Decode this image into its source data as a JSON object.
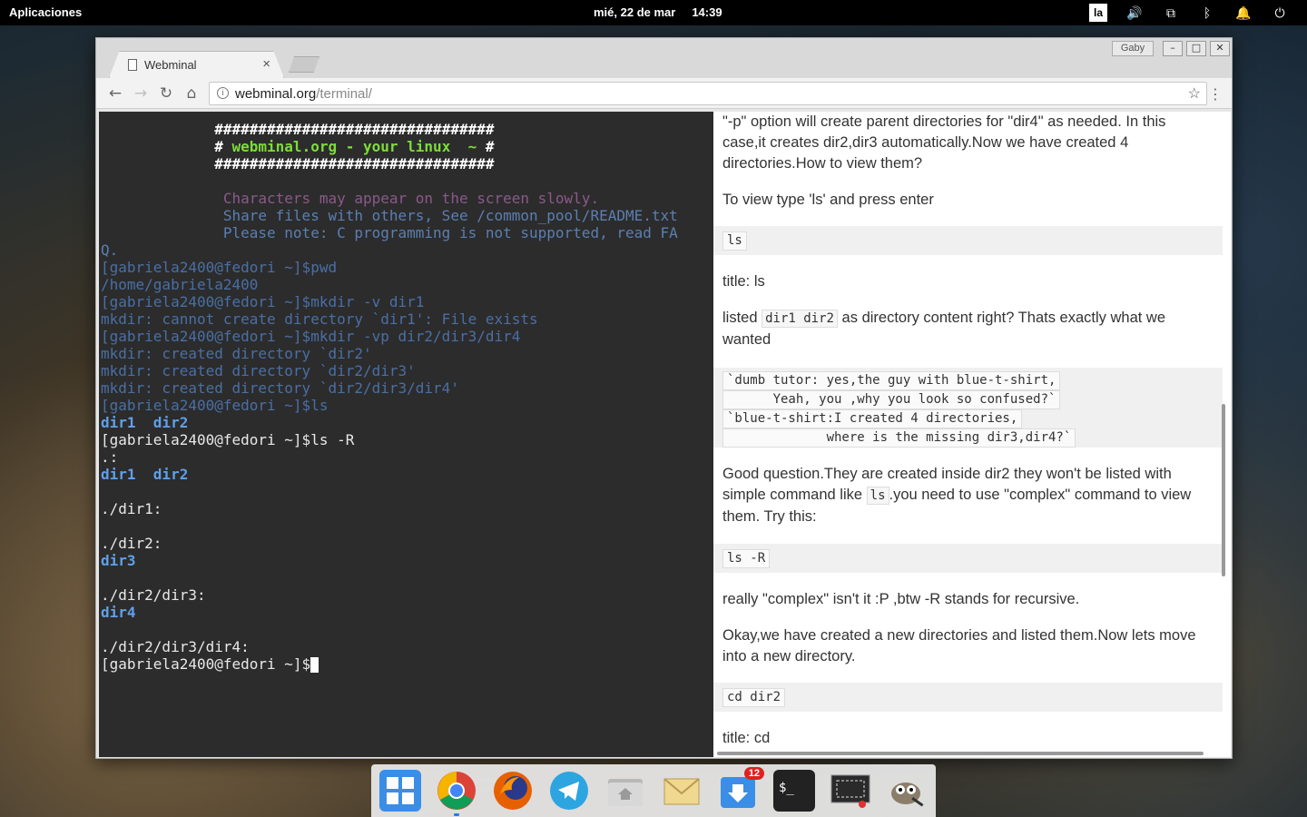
{
  "top_panel": {
    "apps_label": "Aplicaciones",
    "date": "mié, 22 de mar",
    "time": "14:39",
    "lang": "la"
  },
  "browser": {
    "tab_title": "Webminal",
    "profile": "Gaby",
    "url_host": "webminal.org",
    "url_path": "/terminal/"
  },
  "terminal": {
    "banner_hash": "################################",
    "banner_title_pre": "# ",
    "banner_title": "webminal.org - your linux  ~",
    "banner_title_post": " #",
    "motd1": "Characters may appear on the screen slowly.",
    "motd2": "Share files with others, See /common_pool/README.txt",
    "motd3": "Please note: C programming is not supported, read FA",
    "motd3b": "Q.",
    "l1": "[gabriela2400@fedori ~]$pwd",
    "l2": "/home/gabriela2400",
    "l3": "[gabriela2400@fedori ~]$mkdir -v dir1",
    "l4": "mkdir: cannot create directory `dir1': File exists",
    "l5": "[gabriela2400@fedori ~]$mkdir -vp dir2/dir3/dir4",
    "l6": "mkdir: created directory `dir2'",
    "l7": "mkdir: created directory `dir2/dir3'",
    "l8": "mkdir: created directory `dir2/dir3/dir4'",
    "l9": "[gabriela2400@fedori ~]$ls",
    "l10": "dir1  dir2",
    "l11": "[gabriela2400@fedori ~]$ls -R",
    "l12": ".:",
    "l13": "dir1  dir2",
    "l14": "./dir1:",
    "l15": "./dir2:",
    "l16": "dir3",
    "l17": "./dir2/dir3:",
    "l18": "dir4",
    "l19": "./dir2/dir3/dir4:",
    "prompt": "[gabriela2400@fedori ~]$"
  },
  "tutorial": {
    "p1": "\"-p\" option will create parent directories for \"dir4\" as needed. In this case,it creates dir2,dir3 automatically.Now we have created 4 directories.How to view them?",
    "p2": "To view type 'ls' and press enter",
    "code1": "ls",
    "p3": "title: ls",
    "p4_pre": "listed ",
    "p4_code": "dir1 dir2",
    "p4_post": " as directory content right? Thats exactly what we wanted",
    "dialog1": "`dumb tutor: yes,the guy with blue-t-shirt,",
    "dialog2": "      Yeah, you ,why you look so confused?`",
    "dialog3": "`blue-t-shirt:I created 4 directories,",
    "dialog4": "             where is the missing dir3,dir4?`",
    "p5_pre": "Good question.They are created inside dir2 they won't be listed with simple command like ",
    "p5_code": "ls",
    "p5_post": ".you need to use \"complex\" command to view them. Try this:",
    "code2": "ls -R",
    "p6": "really \"complex\" isn't it :P ,btw -R stands for recursive.",
    "p7": "Okay,we have created a new directories and listed them.Now lets move into a new directory.",
    "code3": "cd dir2",
    "p8": "title: cd"
  },
  "dock": {
    "badge": "12",
    "items": [
      "multitasking-view-icon",
      "chrome-icon",
      "firefox-icon",
      "telegram-icon",
      "files-icon",
      "mail-icon",
      "updates-icon",
      "terminal-icon",
      "screenshot-icon",
      "gimp-icon"
    ]
  },
  "colors": {
    "terminal_bg": "#2c2c2c",
    "prompt_old": "#4a6fa5",
    "dir_blue": "#5fa0e8",
    "banner_green": "#7ddc3a"
  }
}
